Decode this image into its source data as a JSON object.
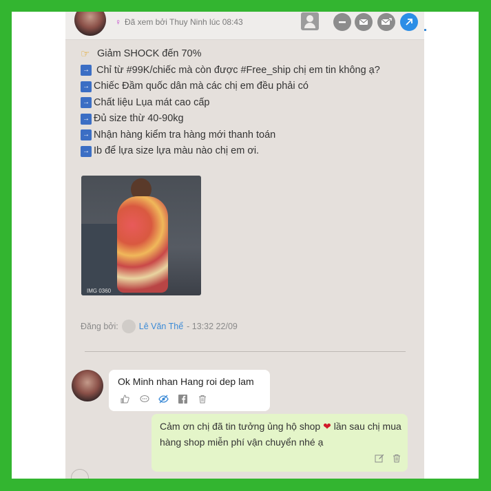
{
  "header": {
    "seen_text": "Đã xem bởi Thuy Ninh lúc 08:43",
    "icons": [
      "user-icon",
      "minus-circle-icon",
      "mail-icon",
      "mail-send-icon",
      "external-link-icon"
    ]
  },
  "post": {
    "lines": [
      "Giảm SHOCK đến 70%",
      "Chỉ từ #99K/chiếc mà còn được #Free_ship chị em tin không ạ?",
      "Chiếc Đầm quốc dân mà các chị em đều phải có",
      "Chất liệu Lụa mát cao cấp",
      "Đủ size thừ 40-90kg",
      "Nhận hàng kiểm tra hàng mới thanh toán",
      "Ib để lựa size lựa màu nào chị em ơi."
    ],
    "photo_caption": "IMG 0360",
    "byline_prefix": "Đăng bởi:",
    "author": "Lê Văn Thể",
    "byline_time": "- 13:32 22/09"
  },
  "comments": {
    "customer_text": "Ok Minh nhan Hang roi dep lam",
    "shop_reply_part1": "Cảm ơn chị đã tin tưởng ủng hộ shop",
    "shop_reply_part2": "lần sau chị mua hàng shop miễn phí vận chuyển nhé ạ"
  },
  "colors": {
    "frame": "#33b530",
    "panel": "#e5e0dc",
    "reply_bubble": "#e4f5c9",
    "link": "#3b8ad6",
    "send_button": "#2c8ee6"
  }
}
